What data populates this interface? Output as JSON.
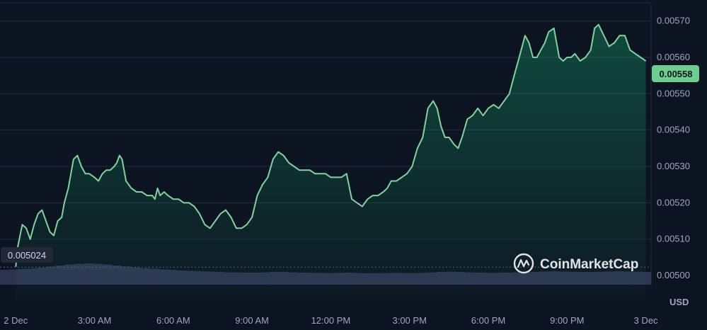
{
  "chart_data": {
    "type": "area",
    "currency": "USD",
    "watermark": "CoinMarketCap",
    "current_price_label": "0.00558",
    "open_price_label": "0.005024",
    "open_price": 0.005024,
    "line_color": "#7fd49b",
    "fill_color": "#16c784",
    "badge_color": "#6ccf8f",
    "ylim": [
      0.00493,
      0.00575
    ],
    "y_ticks": [
      {
        "value": 0.0057,
        "label": "0.00570"
      },
      {
        "value": 0.0056,
        "label": "0.00560"
      },
      {
        "value": 0.0055,
        "label": "0.00550"
      },
      {
        "value": 0.0054,
        "label": "0.00540"
      },
      {
        "value": 0.0053,
        "label": "0.00530"
      },
      {
        "value": 0.0052,
        "label": "0.00520"
      },
      {
        "value": 0.0051,
        "label": "0.00510"
      },
      {
        "value": 0.005,
        "label": "0.00500"
      }
    ],
    "x_ticks": [
      "2 Dec",
      "3:00 AM",
      "6:00 AM",
      "9:00 AM",
      "12:00 PM",
      "3:00 PM",
      "6:00 PM",
      "9:00 PM",
      "3 Dec"
    ],
    "x_range_hours": [
      -0.6,
      24.2
    ],
    "series": [
      {
        "hours": [
          0.0,
          0.08,
          0.25,
          0.4,
          0.55,
          0.7,
          0.85,
          1.0,
          1.15,
          1.3,
          1.45,
          1.6,
          1.75,
          1.85,
          2.0,
          2.1,
          2.2,
          2.35,
          2.5,
          2.65,
          2.8,
          3.0,
          3.15,
          3.3,
          3.45,
          3.6,
          3.75,
          3.85,
          3.95,
          4.05,
          4.2,
          4.4,
          4.6,
          4.8,
          5.0,
          5.2,
          5.3,
          5.4,
          5.5,
          5.65,
          5.8,
          6.0,
          6.2,
          6.4,
          6.6,
          6.8,
          7.0,
          7.2,
          7.4,
          7.6,
          7.8,
          8.0,
          8.2,
          8.4,
          8.6,
          8.8,
          9.0,
          9.2,
          9.4,
          9.6,
          9.8,
          10.0,
          10.2,
          10.4,
          10.6,
          10.8,
          11.0,
          11.2,
          11.4,
          11.6,
          11.8,
          12.0,
          12.2,
          12.4,
          12.6,
          12.8,
          13.0,
          13.2,
          13.4,
          13.6,
          13.8,
          14.0,
          14.15,
          14.3,
          14.5,
          14.7,
          14.9,
          15.1,
          15.3,
          15.5,
          15.7,
          15.9,
          16.05,
          16.2,
          16.35,
          16.5,
          16.6,
          16.7,
          16.85,
          17.0,
          17.2,
          17.4,
          17.6,
          17.8,
          18.0,
          18.2,
          18.4,
          18.6,
          18.8,
          18.95,
          19.1,
          19.25,
          19.4,
          19.55,
          19.7,
          19.85,
          20.0,
          20.15,
          20.3,
          20.5,
          20.7,
          20.85,
          21.0,
          21.15,
          21.3,
          21.5,
          21.7,
          21.9,
          22.05,
          22.2,
          22.4,
          22.6,
          22.8,
          23.0,
          23.2,
          23.4,
          23.6,
          23.8,
          24.0
        ],
        "values": [
          0.005024,
          0.00508,
          0.00514,
          0.00513,
          0.0051,
          0.00514,
          0.00517,
          0.00518,
          0.00515,
          0.00512,
          0.00511,
          0.00515,
          0.00516,
          0.0052,
          0.00524,
          0.00528,
          0.00532,
          0.00533,
          0.0053,
          0.00528,
          0.00528,
          0.00527,
          0.00526,
          0.00528,
          0.00529,
          0.00529,
          0.0053,
          0.00531,
          0.00533,
          0.00532,
          0.00526,
          0.00524,
          0.00523,
          0.00523,
          0.00522,
          0.00522,
          0.00521,
          0.00524,
          0.00522,
          0.00523,
          0.00522,
          0.00521,
          0.00521,
          0.0052,
          0.0052,
          0.00519,
          0.00517,
          0.00514,
          0.00513,
          0.00515,
          0.00517,
          0.00518,
          0.00516,
          0.00513,
          0.00513,
          0.00514,
          0.00516,
          0.00522,
          0.00525,
          0.00527,
          0.00532,
          0.00534,
          0.00533,
          0.00531,
          0.0053,
          0.00529,
          0.00529,
          0.00529,
          0.00528,
          0.00528,
          0.00528,
          0.00527,
          0.00527,
          0.00527,
          0.00528,
          0.00521,
          0.0052,
          0.00519,
          0.00521,
          0.00522,
          0.00522,
          0.00523,
          0.00524,
          0.00526,
          0.00526,
          0.00527,
          0.00528,
          0.0053,
          0.00535,
          0.00538,
          0.00546,
          0.00548,
          0.00546,
          0.00541,
          0.00538,
          0.00538,
          0.00537,
          0.00536,
          0.00535,
          0.00538,
          0.00543,
          0.00544,
          0.00546,
          0.00544,
          0.00546,
          0.00547,
          0.00546,
          0.00548,
          0.0055,
          0.00554,
          0.00558,
          0.00562,
          0.00566,
          0.00564,
          0.0056,
          0.0056,
          0.00562,
          0.00564,
          0.00567,
          0.00568,
          0.0056,
          0.00559,
          0.0056,
          0.0056,
          0.00561,
          0.00559,
          0.0056,
          0.00562,
          0.00568,
          0.00569,
          0.00566,
          0.00563,
          0.00564,
          0.00566,
          0.00566,
          0.00562,
          0.00561,
          0.0056,
          0.00559,
          0.00559,
          0.00558
        ]
      }
    ],
    "volume": {
      "color": "#2c3450",
      "values": [
        0.7,
        0.72,
        0.74,
        0.76,
        0.8,
        0.85,
        0.9,
        0.95,
        0.98,
        1.0,
        0.98,
        0.95,
        0.9,
        0.86,
        0.82,
        0.78,
        0.75,
        0.72,
        0.7,
        0.67,
        0.65,
        0.63,
        0.62,
        0.6,
        0.58,
        0.58,
        0.57,
        0.57,
        0.58,
        0.6,
        0.6,
        0.58,
        0.57,
        0.56,
        0.56,
        0.55,
        0.56,
        0.57,
        0.55,
        0.54,
        0.54,
        0.55,
        0.56,
        0.55,
        0.55,
        0.56,
        0.58,
        0.6,
        0.61,
        0.6,
        0.58,
        0.57,
        0.56,
        0.56,
        0.57,
        0.58,
        0.59,
        0.6,
        0.62,
        0.63,
        0.62,
        0.61,
        0.6,
        0.6,
        0.61,
        0.62,
        0.63,
        0.62,
        0.61,
        0.6
      ]
    }
  }
}
